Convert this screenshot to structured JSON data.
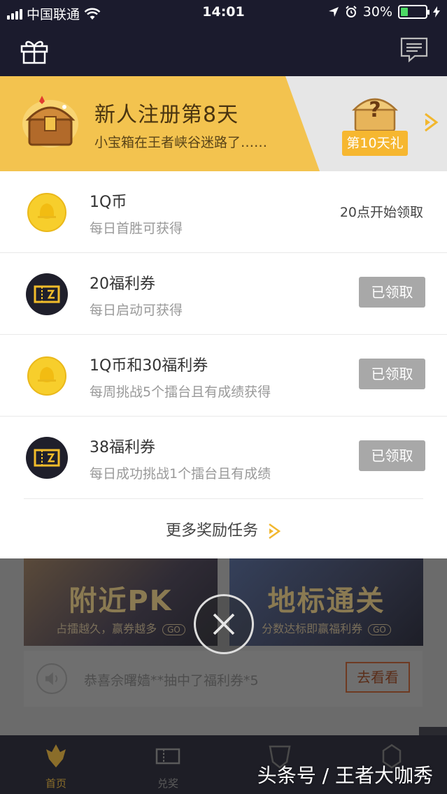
{
  "status_bar": {
    "carrier": "中国联通",
    "time": "14:01",
    "battery": "30%",
    "battery_level": 0.3
  },
  "header": {
    "left_icon": "gift-icon",
    "right_icon": "message-icon"
  },
  "banner": {
    "title": "新人注册第8天",
    "subtitle": "小宝箱在王者峡谷迷路了……",
    "reward_label": "第10天礼",
    "colors": {
      "accent": "#f3c34f",
      "badge": "#f6b730"
    }
  },
  "rewards": [
    {
      "title": "1Q币",
      "desc": "每日首胜可获得",
      "status": "20点开始领取",
      "icon": "qq-coin-icon"
    },
    {
      "title": "20福利券",
      "desc": "每日启动可获得",
      "status": "已领取",
      "icon": "ticket-icon"
    },
    {
      "title": "1Q币和30福利券",
      "desc": "每周挑战5个擂台且有成绩获得",
      "status": "已领取",
      "icon": "qq-coin-icon"
    },
    {
      "title": "38福利券",
      "desc": "每日成功挑战1个擂台且有成绩",
      "status": "已领取",
      "icon": "ticket-icon"
    }
  ],
  "more_tasks": "更多奖励任务",
  "background": {
    "promo_left": {
      "title": "附近PK",
      "subtitle": "占擂越久，赢券越多",
      "go": "GO"
    },
    "promo_right": {
      "title": "地标通关",
      "subtitle": "分数达标即赢福利券",
      "go": "GO"
    },
    "notice": {
      "text": "恭喜佘曙嫱**抽中了福利券*5",
      "button": "去看看"
    },
    "tabs": [
      {
        "label": "首页",
        "active": true
      },
      {
        "label": "兑奖",
        "active": false
      }
    ]
  },
  "watermark": "头条号 / 王者大咖秀"
}
